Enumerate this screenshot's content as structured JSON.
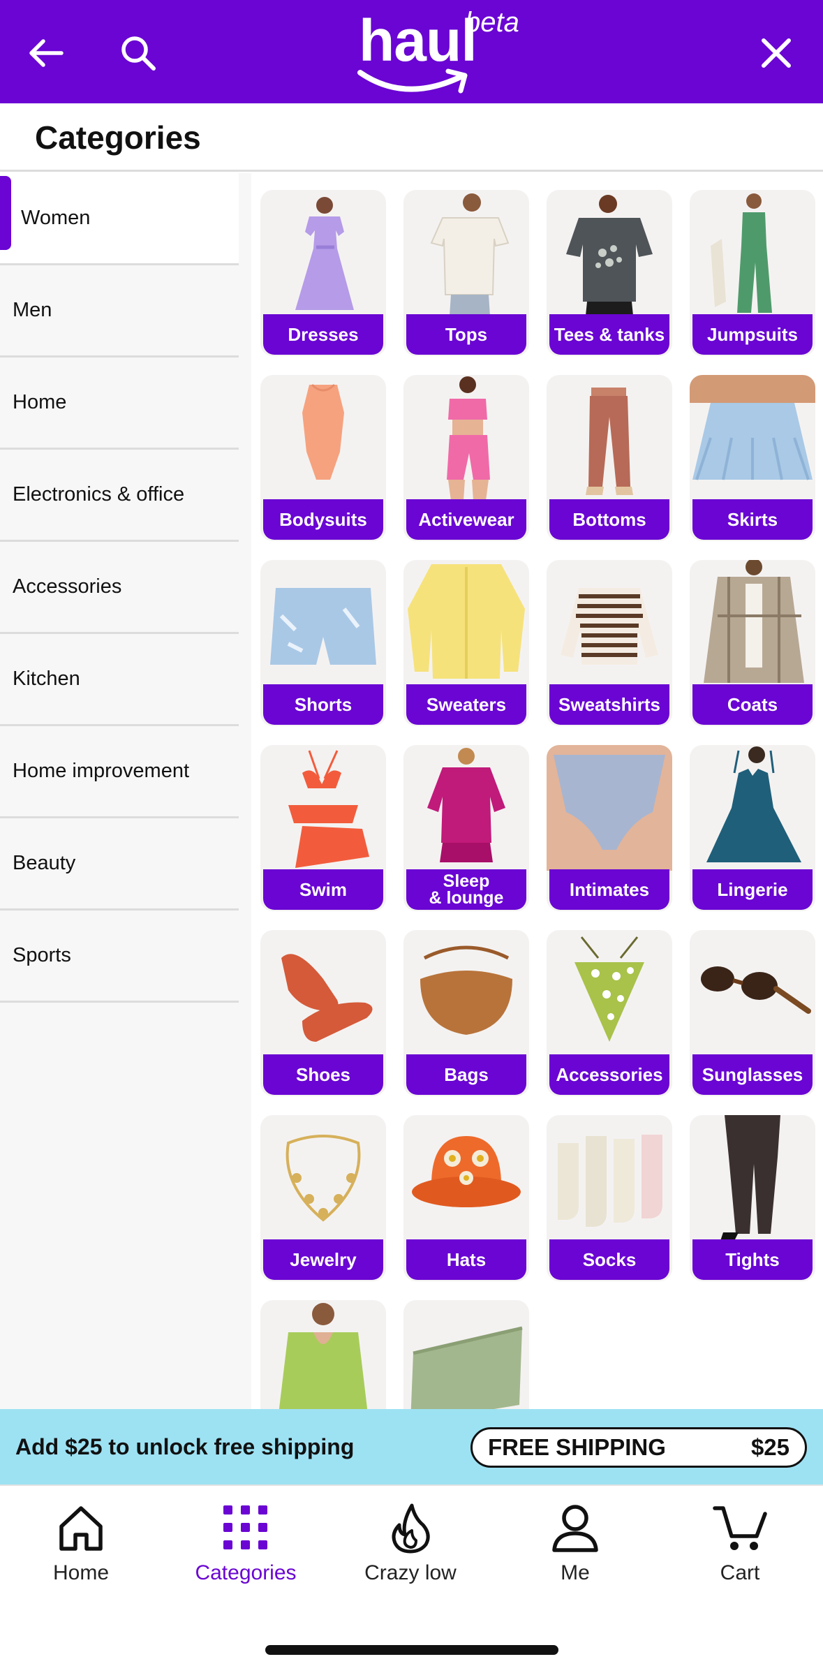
{
  "colors": {
    "brand": "#6A05D3",
    "banner": "#9DE2F3"
  },
  "header": {
    "logo_text": "haul",
    "logo_badge": "beta",
    "back_icon": "arrow-left-icon",
    "search_icon": "search-icon",
    "close_icon": "close-icon"
  },
  "page_title": "Categories",
  "sidebar": {
    "items": [
      {
        "label": "Women",
        "active": true
      },
      {
        "label": "Men"
      },
      {
        "label": "Home"
      },
      {
        "label": "Electronics & office"
      },
      {
        "label": "Accessories"
      },
      {
        "label": "Kitchen"
      },
      {
        "label": "Home improvement"
      },
      {
        "label": "Beauty"
      },
      {
        "label": "Sports"
      }
    ]
  },
  "grid": {
    "tiles": [
      {
        "label": "Dresses",
        "image": "dress-image"
      },
      {
        "label": "Tops",
        "image": "top-image"
      },
      {
        "label": "Tees & tanks",
        "image": "tee-image"
      },
      {
        "label": "Jumpsuits",
        "image": "jumpsuit-image"
      },
      {
        "label": "Bodysuits",
        "image": "bodysuit-image"
      },
      {
        "label": "Activewear",
        "image": "activewear-image"
      },
      {
        "label": "Bottoms",
        "image": "pants-image"
      },
      {
        "label": "Skirts",
        "image": "skirt-image"
      },
      {
        "label": "Shorts",
        "image": "shorts-image"
      },
      {
        "label": "Sweaters",
        "image": "sweater-image"
      },
      {
        "label": "Sweatshirts",
        "image": "sweatshirt-image"
      },
      {
        "label": "Coats",
        "image": "coat-image"
      },
      {
        "label": "Swim",
        "image": "swimsuit-image"
      },
      {
        "label": "Sleep\n& lounge",
        "image": "sleepwear-image"
      },
      {
        "label": "Intimates",
        "image": "intimates-image"
      },
      {
        "label": "Lingerie",
        "image": "lingerie-image"
      },
      {
        "label": "Shoes",
        "image": "shoes-image"
      },
      {
        "label": "Bags",
        "image": "bag-image"
      },
      {
        "label": "Accessories",
        "image": "bandana-image"
      },
      {
        "label": "Sunglasses",
        "image": "sunglasses-image"
      },
      {
        "label": "Jewelry",
        "image": "jewelry-image"
      },
      {
        "label": "Hats",
        "image": "hat-image"
      },
      {
        "label": "Socks",
        "image": "socks-image"
      },
      {
        "label": "Tights",
        "image": "tights-image"
      },
      {
        "label": "",
        "image": "green-top-image"
      },
      {
        "label": "",
        "image": "pouch-image"
      }
    ]
  },
  "shipping_banner": {
    "message": "Add $25 to unlock free shipping",
    "pill_label": "FREE SHIPPING",
    "pill_amount": "$25"
  },
  "bottom_nav": {
    "items": [
      {
        "label": "Home",
        "icon": "home-icon"
      },
      {
        "label": "Categories",
        "icon": "grid-icon",
        "active": true
      },
      {
        "label": "Crazy low",
        "icon": "flame-icon"
      },
      {
        "label": "Me",
        "icon": "person-icon"
      },
      {
        "label": "Cart",
        "icon": "cart-icon"
      }
    ]
  }
}
